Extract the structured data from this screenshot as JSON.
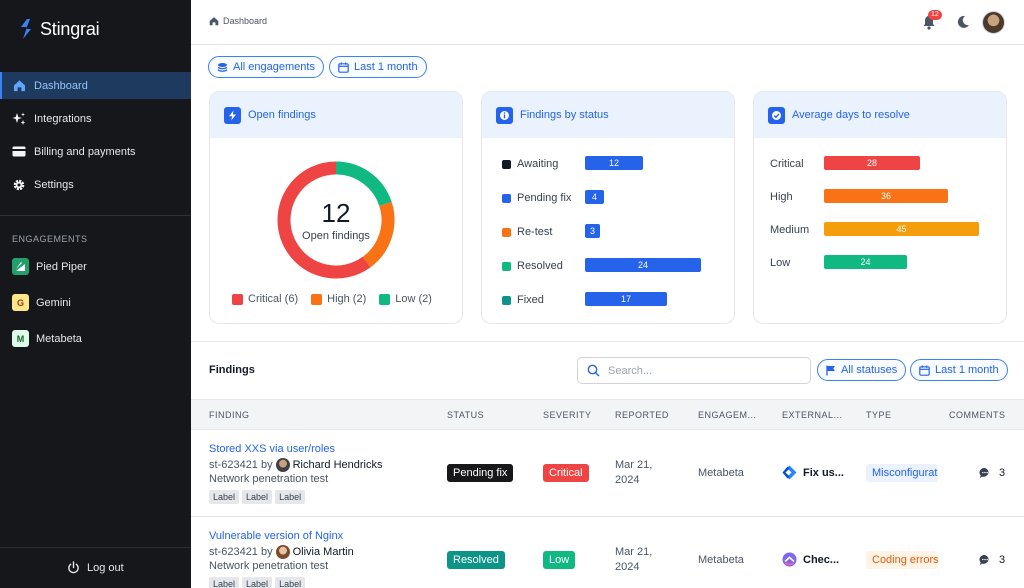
{
  "app": {
    "name": "Stingrai"
  },
  "sidebar": {
    "nav": [
      {
        "label": "Dashboard",
        "icon": "home-icon",
        "active": true
      },
      {
        "label": "Integrations",
        "icon": "sparkle-icon"
      },
      {
        "label": "Billing and payments",
        "icon": "credit-card-icon"
      },
      {
        "label": "Settings",
        "icon": "gear-icon"
      }
    ],
    "engagements_heading": "ENGAGEMENTS",
    "engagements": [
      {
        "label": "Pied Piper",
        "badge": "",
        "color": "#22a06b"
      },
      {
        "label": "Gemini",
        "badge": "G",
        "color": "#fde68a"
      },
      {
        "label": "Metabeta",
        "badge": "M",
        "color": "#dcfce7"
      }
    ],
    "logout": "Log out"
  },
  "header": {
    "breadcrumb": "Dashboard",
    "notifications": "12"
  },
  "filters": {
    "engagements": "All engagements",
    "period": "Last 1 month"
  },
  "cards": {
    "open_findings": {
      "title": "Open findings",
      "total": "12",
      "caption": "Open findings",
      "legend": [
        {
          "label": "Critical (6)",
          "value": 6,
          "color": "#ef4444"
        },
        {
          "label": "High (2)",
          "value": 2,
          "color": "#f97316"
        },
        {
          "label": "Low (2)",
          "value": 2,
          "color": "#10b981"
        }
      ]
    },
    "by_status": {
      "title": "Findings by status",
      "rows": [
        {
          "label": "Awaiting",
          "value": 12,
          "text": "12",
          "color": "#111827"
        },
        {
          "label": "Pending fix",
          "value": 4,
          "text": "4",
          "color": "#2563eb"
        },
        {
          "label": "Re-test",
          "value": 3,
          "text": "3",
          "color": "#f97316"
        },
        {
          "label": "Resolved",
          "value": 24,
          "text": "24",
          "color": "#10b981"
        },
        {
          "label": "Fixed",
          "value": 17,
          "text": "17",
          "color": "#0d9488"
        }
      ]
    },
    "avg_days": {
      "title": "Average days to resolve",
      "rows": [
        {
          "label": "Critical",
          "value": 28,
          "text": "28",
          "color": "#ef4444"
        },
        {
          "label": "High",
          "value": 36,
          "text": "36",
          "color": "#f97316"
        },
        {
          "label": "Medium",
          "value": 45,
          "text": "45",
          "color": "#f59e0b"
        },
        {
          "label": "Low",
          "value": 24,
          "text": "24",
          "color": "#10b981"
        }
      ]
    }
  },
  "findings": {
    "title": "Findings",
    "search_placeholder": "Search...",
    "status_filter": "All statuses",
    "period_filter": "Last 1 month",
    "columns": [
      "FINDING",
      "STATUS",
      "SEVERITY",
      "REPORTED",
      "ENGAGEM...",
      "EXTERNAL...",
      "TYPE",
      "COMMENTS"
    ],
    "rows": [
      {
        "title": "Stored XXS via user/roles",
        "id_prefix": "st-623421 by",
        "author": "Richard Hendricks",
        "subtitle": "Network penetration test",
        "labels": [
          "Label",
          "Label",
          "Label"
        ],
        "status": "Pending fix",
        "status_color": "#18181b",
        "severity": "Critical",
        "severity_color": "#ef4444",
        "reported_line1": "Mar 21,",
        "reported_line2": "2024",
        "engagement": "Metabeta",
        "external": "Fix us...",
        "external_icon": "jira-icon",
        "type": "Misconfiguration",
        "type_bg": "#eaf2fd",
        "type_fg": "#2563eb",
        "comments": "3"
      },
      {
        "title": "Vulnerable version of Nginx",
        "id_prefix": "st-623421 by",
        "author": "Olivia Martin",
        "subtitle": "Network penetration test",
        "labels": [
          "Label",
          "Label",
          "Label"
        ],
        "status": "Resolved",
        "status_color": "#0d9488",
        "severity": "Low",
        "severity_color": "#10b981",
        "reported_line1": "Mar 21,",
        "reported_line2": "2024",
        "engagement": "Metabeta",
        "external": "Chec...",
        "external_icon": "clickup-icon",
        "type": "Coding errors",
        "type_bg": "#fff4e5",
        "type_fg": "#ea580c",
        "comments": "3"
      }
    ]
  }
}
